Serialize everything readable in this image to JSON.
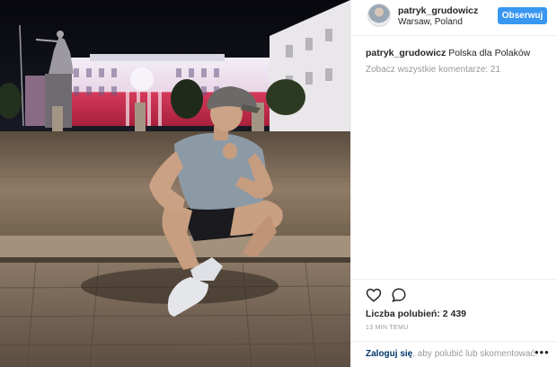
{
  "post": {
    "username": "patryk_grudowicz",
    "location": "Warsaw, Poland",
    "follow_label": "Obserwuj",
    "caption_user": "patryk_grudowicz",
    "caption_text": "Polska dla Polaków",
    "view_all_comments": "Zobacz wszystkie komentarze: 21",
    "likes": "Liczba polubień: 2 439",
    "time": "13 MIN TEMU",
    "login_link": "Zaloguj się",
    "login_rest": ", aby polubić lub skomentować.",
    "more": "•••"
  },
  "colors": {
    "follow_button": "#3897f0",
    "login_link": "#003569",
    "muted_text": "#999999"
  },
  "icons": {
    "like": "heart-icon",
    "comment": "comment-bubble-icon",
    "more": "more-options-icon"
  }
}
